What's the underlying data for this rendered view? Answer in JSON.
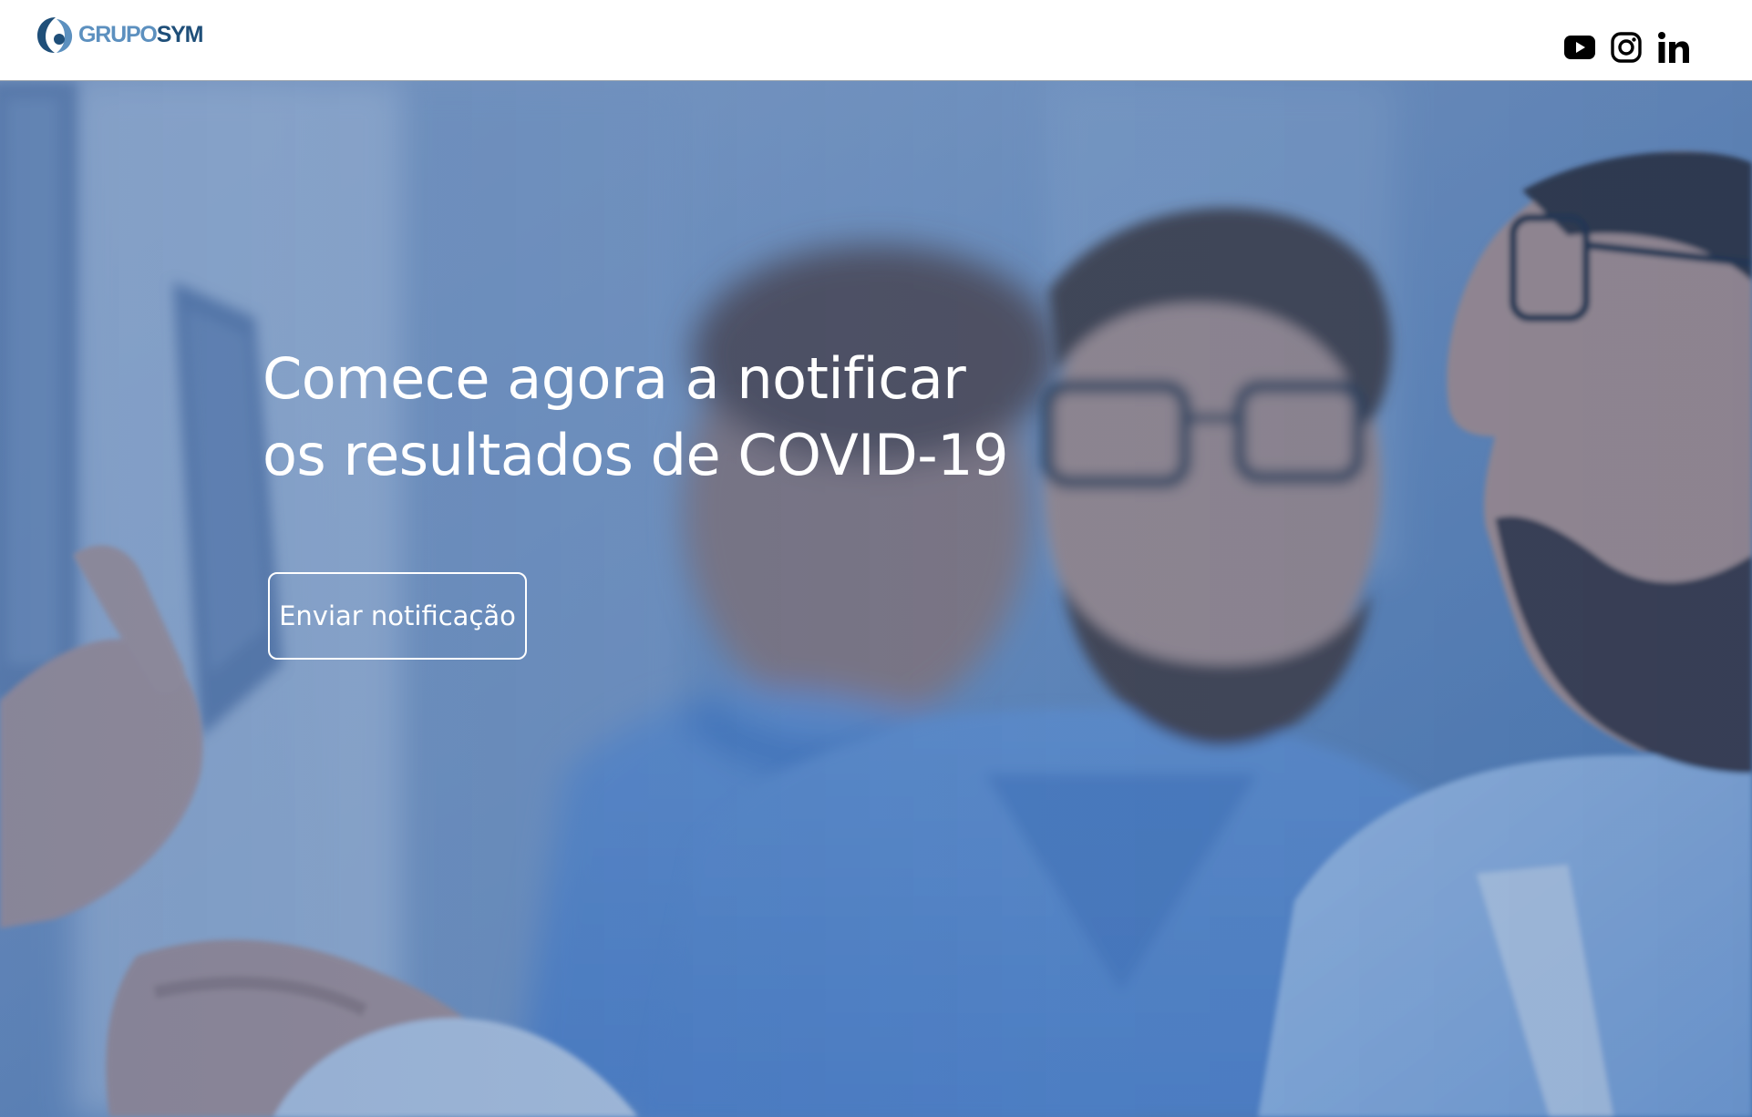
{
  "header": {
    "logo": {
      "word1": "GRUPO",
      "word2": "SYM",
      "color_light": "#5c90bf",
      "color_dark": "#1f4f79"
    },
    "social": [
      {
        "name": "youtube",
        "icon": "youtube-icon"
      },
      {
        "name": "instagram",
        "icon": "instagram-icon"
      },
      {
        "name": "linkedin",
        "icon": "linkedin-icon"
      }
    ]
  },
  "hero": {
    "image": "blurred-photo-of-three-doctors-examining-x-ray-blue-tint",
    "tint_color": "#4e79b0",
    "headline_line1": "Comece agora a notificar",
    "headline_line2": "os resultados de COVID-19",
    "cta_label": "Enviar notificação"
  }
}
